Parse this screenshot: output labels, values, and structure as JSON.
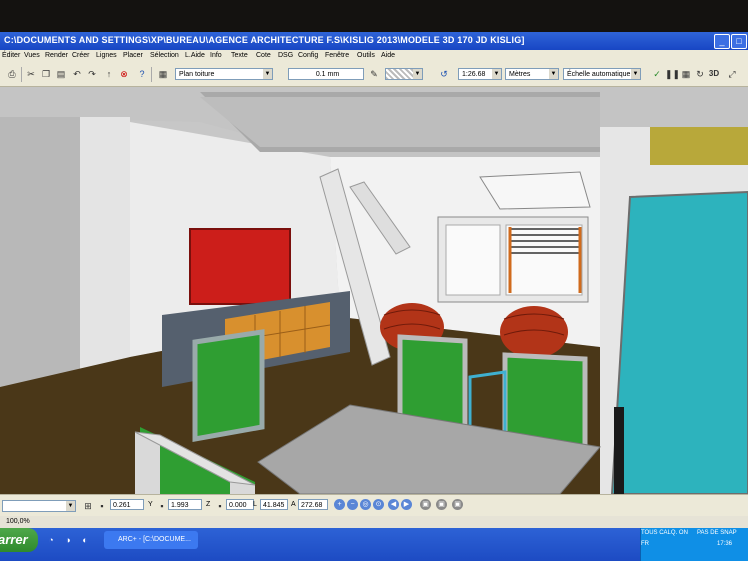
{
  "window": {
    "title": "C:\\DOCUMENTS AND SETTINGS\\XP\\BUREAU\\AGENCE ARCHITECTURE F.S\\KISLIG 2013\\MODELE 3D 170 JD KISLIG]"
  },
  "menu": {
    "items": [
      "Éditer",
      "Vues",
      "Render",
      "Créer",
      "Lignes",
      "Placer",
      "Sélection",
      "L.Aide",
      "Info",
      "Texte",
      "Cote",
      "DSG",
      "Config",
      "Fenêtre",
      "Outils",
      "Aide"
    ]
  },
  "toolbar": {
    "layer_combo": "Plan toiture",
    "lineweight_combo": "0.1 mm",
    "scale_combo": "1:26.68",
    "units_combo": "Mètres",
    "echelle_combo": "Échelle automatique",
    "view_3d_label": "3D"
  },
  "status": {
    "zoom_text": "100,0%",
    "x_label": "X",
    "x_value": "0.261",
    "y_label": "Y",
    "y_value": "1.993",
    "z_label": "Z",
    "z_value": "0.000",
    "l_label": "L",
    "l_value": "41.845",
    "a_label": "A",
    "a_value": "272.68"
  },
  "taskbar": {
    "start_label": "arrer",
    "task_label": "ARC+ - [C:\\DOCUME...",
    "status_calq": "TOUS CALQ. ON",
    "status_snap": "PAS DE SNAP",
    "lang": "FR",
    "clock": "17:36"
  },
  "colors": {
    "titlebar": "#1846c4",
    "sofa_red": "#b23418",
    "chair_green": "#2f9e32",
    "wall_panel_cyan": "#2db3bd",
    "wall_painting_red": "#cc1e1a"
  }
}
